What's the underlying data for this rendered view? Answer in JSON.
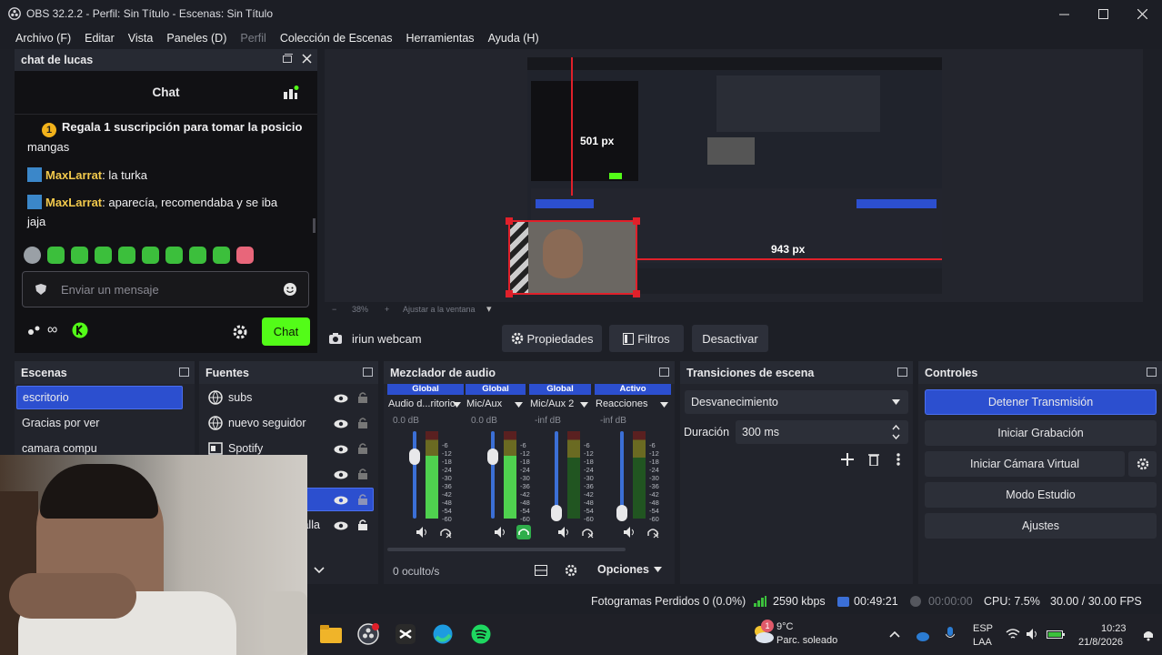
{
  "window": {
    "title": "OBS 32.2.2 - Perfil: Sin Título - Escenas: Sin Título"
  },
  "menu": [
    "Archivo (F)",
    "Editar",
    "Vista",
    "Paneles (D)",
    "Perfil",
    "Colección de Escenas",
    "Herramientas",
    "Ayuda (H)"
  ],
  "chat_dock": {
    "title": "chat de lucas",
    "header": "Chat",
    "pinned": "Regala 1 suscripción para tomar la posicio",
    "pinned_cont": "mangas",
    "messages": [
      {
        "user": "MaxLarrat",
        "text": ": la turka"
      },
      {
        "user": "MaxLarrat",
        "text": ": aparecía, recomendaba y se iba"
      }
    ],
    "msg_cont": "jaja",
    "input_placeholder": "Enviar un mensaje",
    "send_label": "Chat",
    "infinity": "∞"
  },
  "preview": {
    "zoom": "38%",
    "fit_label": "Ajustar a la ventana",
    "dim1": "501 px",
    "dim2": "943 px"
  },
  "source_toolbar": {
    "source_name": "iriun webcam",
    "properties": "Propiedades",
    "filters": "Filtros",
    "deactivate": "Desactivar"
  },
  "scenes": {
    "title": "Escenas",
    "items": [
      "escritorio",
      "Gracias por ver",
      "camara compu"
    ]
  },
  "sources": {
    "title": "Fuentes",
    "items": [
      "subs",
      "nuevo seguidor",
      "Spotify",
      "",
      "",
      "talla"
    ]
  },
  "mixer": {
    "title": "Mezclador de audio",
    "hidden": "0 oculto/s",
    "options": "Opciones",
    "channels": [
      {
        "scope": "Global",
        "name": "Audio d...ritorio",
        "db": "0.0 dB",
        "level": 0.78
      },
      {
        "scope": "Global",
        "name": "Mic/Aux",
        "db": "0.0 dB",
        "level": 0.78
      },
      {
        "scope": "Global",
        "name": "Mic/Aux 2",
        "db": "-inf dB",
        "level": 0.08
      },
      {
        "scope": "Activo",
        "name": "Reacciones",
        "db": "-inf dB",
        "level": 0.08
      }
    ],
    "scale": [
      "0",
      "-6",
      "-12",
      "-18",
      "-24",
      "-30",
      "-36",
      "-42",
      "-48",
      "-54",
      "-60"
    ]
  },
  "transitions": {
    "title": "Transiciones de escena",
    "type": "Desvanecimiento",
    "duration_label": "Duración",
    "duration_value": "300 ms"
  },
  "controls": {
    "title": "Controles",
    "stop_stream": "Detener Transmisión",
    "start_record": "Iniciar Grabación",
    "start_vcam": "Iniciar Cámara Virtual",
    "studio_mode": "Modo Estudio",
    "settings": "Ajustes"
  },
  "status": {
    "dropped": "Fotogramas Perdidos 0 (0.0%)",
    "bitrate": "2590 kbps",
    "stream_time": "00:49:21",
    "rec_time": "00:00:00",
    "cpu": "CPU: 7.5%",
    "fps": "30.00 / 30.00 FPS"
  },
  "taskbar": {
    "weather_temp": "9°C",
    "weather_desc": "Parc. soleado",
    "lang1": "ESP",
    "lang2": "LAA",
    "time": "10:23",
    "date": "21/8/2026",
    "weather_badge": "1"
  },
  "colors": {
    "accent_blue": "#2c4fcf",
    "kick_green": "#53fc18",
    "username_gold": "#f2c94c"
  }
}
